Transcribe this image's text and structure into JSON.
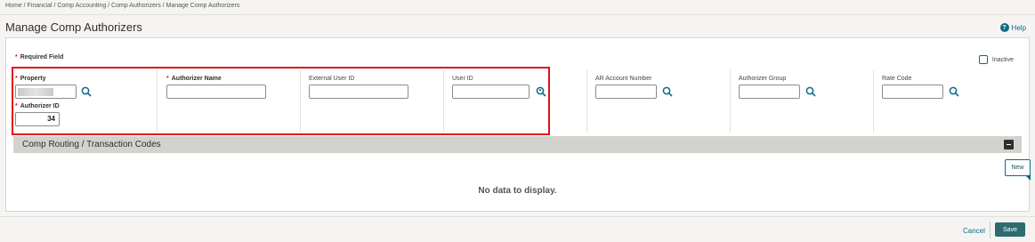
{
  "breadcrumb": "Home / Financial / Comp Accounting / Comp Authorizers / Manage Comp Authorizers",
  "page_title": "Manage Comp Authorizers",
  "help_label": "Help",
  "required_note": "Required Field",
  "inactive_label": "Inactive",
  "fields": {
    "property": {
      "label": "Property",
      "value": ""
    },
    "authorizer_id": {
      "label": "Authorizer ID",
      "value": "34"
    },
    "authorizer_name": {
      "label": "Authorizer Name",
      "value": ""
    },
    "external_user_id": {
      "label": "External User ID",
      "value": ""
    },
    "user_id": {
      "label": "User ID",
      "value": ""
    },
    "ar_account_number": {
      "label": "AR Account Number",
      "value": ""
    },
    "authorizer_group": {
      "label": "Authorizer Group",
      "value": ""
    },
    "rate_code": {
      "label": "Rate Code",
      "value": ""
    }
  },
  "section_title": "Comp Routing / Transaction Codes",
  "new_label": "New",
  "no_data": "No data to display.",
  "cancel_label": "Cancel",
  "save_label": "Save",
  "colors": {
    "accent": "#0f6a84",
    "required": "#c5293a",
    "save": "#2d6b6f",
    "highlight": "#e0101a"
  }
}
